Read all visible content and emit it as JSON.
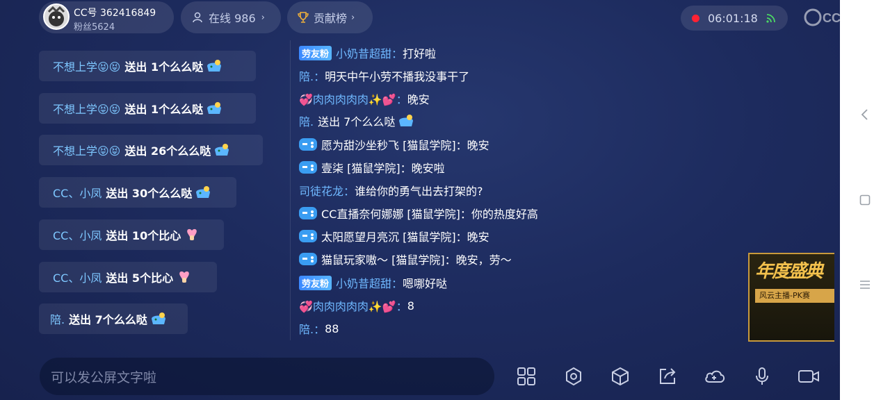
{
  "header": {
    "anchor_id": "CC号 362416849",
    "anchor_fans": "粉丝5624",
    "online_label": "在线 986",
    "contrib_label": "贡献榜",
    "timer": "06:01:18"
  },
  "gifts": [
    {
      "name": "不想上学😝😝",
      "action": "送出 1个么么哒"
    },
    {
      "name": "不想上学😝😝",
      "action": "送出 1个么么哒"
    },
    {
      "name": "不想上学😝😝",
      "action": "送出 26个么么哒"
    },
    {
      "name": "CC、小凤",
      "action": "送出 30个么么哒"
    },
    {
      "name": "CC、小凤",
      "action": "送出 10个比心"
    },
    {
      "name": "CC、小凤",
      "action": "送出 5个比心"
    },
    {
      "name": "陪.",
      "action": "送出 7个么么哒"
    }
  ],
  "chat": [
    {
      "badge": "劳友粉",
      "who": "小奶昔超甜：",
      "msg": "打好啦"
    },
    {
      "who": "陪.：",
      "msg": "明天中午小劳不播我没事干了"
    },
    {
      "who": "💞肉肉肉肉肉✨💕：",
      "msg": "晚安"
    },
    {
      "who": "陪.",
      "msg": "送出 7个么么哒"
    },
    {
      "who": "愿为甜沙坐秒飞 [猫鼠学院]：",
      "msg": "晚安"
    },
    {
      "who": "壹柒 [猫鼠学院]：",
      "msg": "晚安啦"
    },
    {
      "who": "司徒花龙：",
      "msg": "谁给你的勇气出去打架的?"
    },
    {
      "who": "CC直播奈何娜娜 [猫鼠学院]：",
      "msg": "你的热度好高"
    },
    {
      "who": "太阳愿望月亮沉 [猫鼠学院]：",
      "msg": "晚安"
    },
    {
      "who": "猫鼠玩家嗷～ [猫鼠学院]：",
      "msg": "晚安，劳～"
    },
    {
      "badge": "劳友粉",
      "who": "小奶昔超甜：",
      "msg": "嗯哪好哒"
    },
    {
      "who": "💞肉肉肉肉肉✨💕：",
      "msg": "8"
    },
    {
      "who": "陪.：",
      "msg": "88"
    }
  ],
  "banner": {
    "title": "年度盛典",
    "sub": "风云主播-PK赛"
  },
  "input": {
    "placeholder": "可以发公屏文字啦"
  }
}
